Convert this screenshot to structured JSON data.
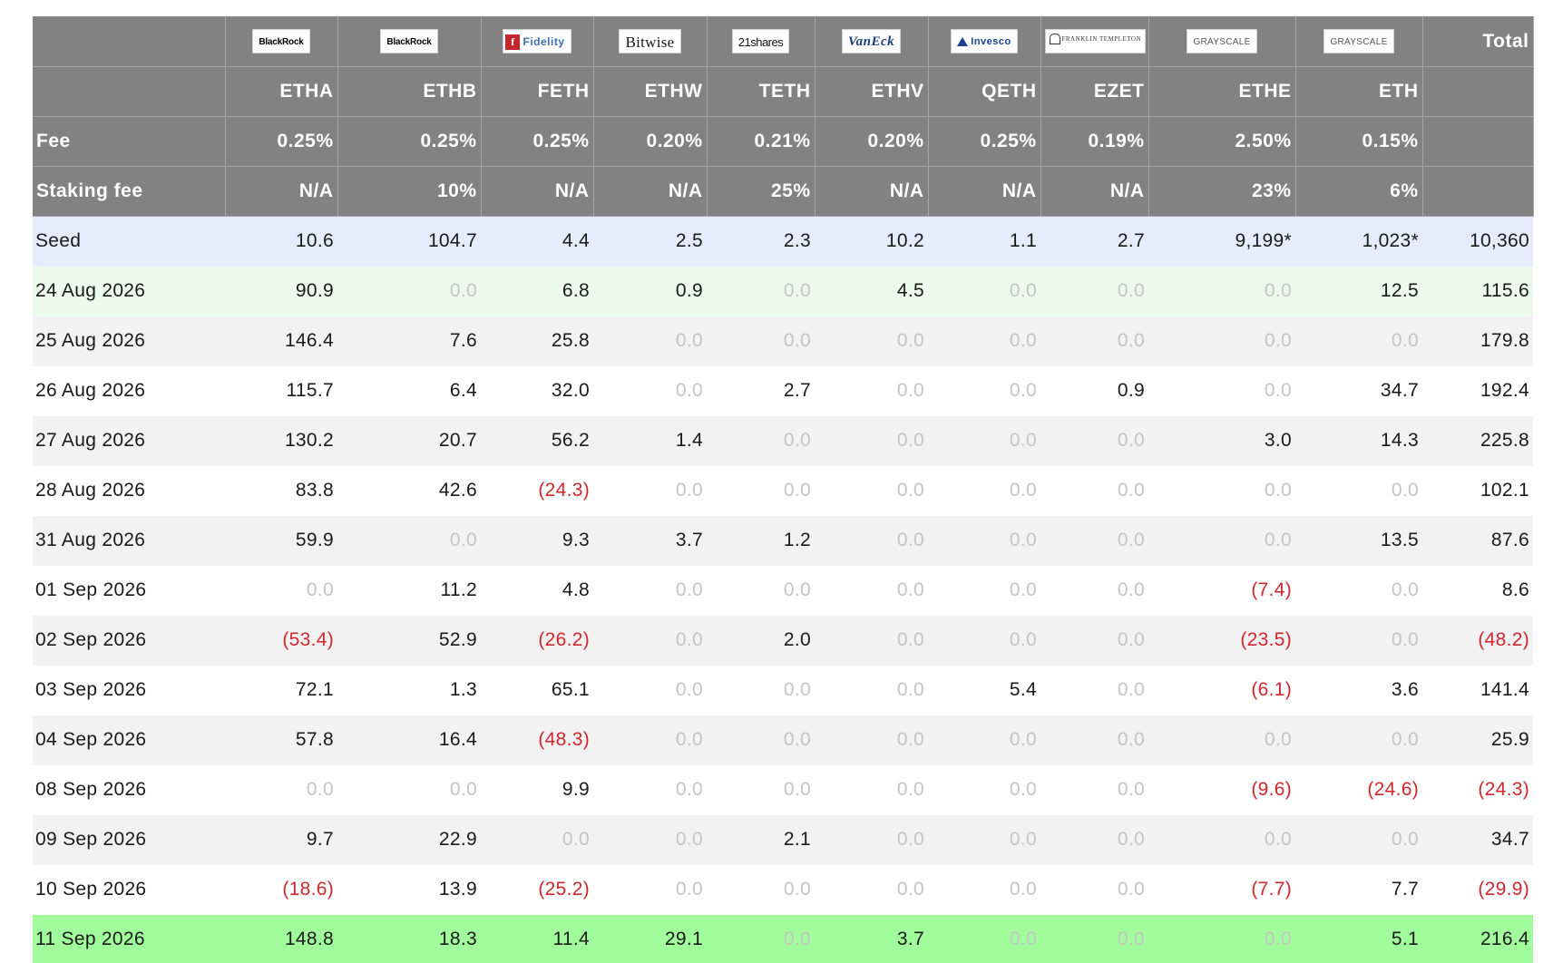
{
  "header": {
    "logos": [
      {
        "text": "BlackRock",
        "icon": "blackrock-logo"
      },
      {
        "text": "BlackRock",
        "icon": "blackrock-logo"
      },
      {
        "text": "Fidelity",
        "icon": "fidelity-logo"
      },
      {
        "text": "Bitwise",
        "icon": "bitwise-logo"
      },
      {
        "text": "21shares",
        "icon": "21shares-logo"
      },
      {
        "text": "VanEck",
        "icon": "vaneck-logo"
      },
      {
        "text": "Invesco",
        "icon": "invesco-logo"
      },
      {
        "text": "FRANKLIN TEMPLETON",
        "icon": "franklin-templeton-logo"
      },
      {
        "text": "GRAYSCALE",
        "icon": "grayscale-logo"
      },
      {
        "text": "GRAYSCALE",
        "icon": "grayscale-logo"
      }
    ],
    "total_label": "Total",
    "tickers": [
      "ETHA",
      "ETHB",
      "FETH",
      "ETHW",
      "TETH",
      "ETHV",
      "QETH",
      "EZET",
      "ETHE",
      "ETH"
    ],
    "fee_label": "Fee",
    "fees": [
      "0.25%",
      "0.25%",
      "0.25%",
      "0.20%",
      "0.21%",
      "0.20%",
      "0.25%",
      "0.19%",
      "2.50%",
      "0.15%"
    ],
    "staking_label": "Staking fee",
    "staking_fees": [
      "N/A",
      "10%",
      "N/A",
      "N/A",
      "25%",
      "N/A",
      "N/A",
      "N/A",
      "23%",
      "6%"
    ]
  },
  "rows": [
    {
      "label": "Seed",
      "values": [
        "10.6",
        "104.7",
        "4.4",
        "2.5",
        "2.3",
        "10.2",
        "1.1",
        "2.7",
        "9,199*",
        "1,023*"
      ],
      "total": "10,360",
      "style": "seed"
    },
    {
      "label": "24 Aug 2026",
      "values": [
        "90.9",
        "0.0",
        "6.8",
        "0.9",
        "0.0",
        "4.5",
        "0.0",
        "0.0",
        "0.0",
        "12.5"
      ],
      "total": "115.6",
      "style": "green-light"
    },
    {
      "label": "25 Aug 2026",
      "values": [
        "146.4",
        "7.6",
        "25.8",
        "0.0",
        "0.0",
        "0.0",
        "0.0",
        "0.0",
        "0.0",
        "0.0"
      ],
      "total": "179.8",
      "style": "even"
    },
    {
      "label": "26 Aug 2026",
      "values": [
        "115.7",
        "6.4",
        "32.0",
        "0.0",
        "2.7",
        "0.0",
        "0.0",
        "0.9",
        "0.0",
        "34.7"
      ],
      "total": "192.4",
      "style": "odd"
    },
    {
      "label": "27 Aug 2026",
      "values": [
        "130.2",
        "20.7",
        "56.2",
        "1.4",
        "0.0",
        "0.0",
        "0.0",
        "0.0",
        "3.0",
        "14.3"
      ],
      "total": "225.8",
      "style": "even"
    },
    {
      "label": "28 Aug 2026",
      "values": [
        "83.8",
        "42.6",
        "(24.3)",
        "0.0",
        "0.0",
        "0.0",
        "0.0",
        "0.0",
        "0.0",
        "0.0"
      ],
      "total": "102.1",
      "style": "odd"
    },
    {
      "label": "31 Aug 2026",
      "values": [
        "59.9",
        "0.0",
        "9.3",
        "3.7",
        "1.2",
        "0.0",
        "0.0",
        "0.0",
        "0.0",
        "13.5"
      ],
      "total": "87.6",
      "style": "even"
    },
    {
      "label": "01 Sep 2026",
      "values": [
        "0.0",
        "11.2",
        "4.8",
        "0.0",
        "0.0",
        "0.0",
        "0.0",
        "0.0",
        "(7.4)",
        "0.0"
      ],
      "total": "8.6",
      "style": "odd"
    },
    {
      "label": "02 Sep 2026",
      "values": [
        "(53.4)",
        "52.9",
        "(26.2)",
        "0.0",
        "2.0",
        "0.0",
        "0.0",
        "0.0",
        "(23.5)",
        "0.0"
      ],
      "total": "(48.2)",
      "style": "even"
    },
    {
      "label": "03 Sep 2026",
      "values": [
        "72.1",
        "1.3",
        "65.1",
        "0.0",
        "0.0",
        "0.0",
        "5.4",
        "0.0",
        "(6.1)",
        "3.6"
      ],
      "total": "141.4",
      "style": "odd"
    },
    {
      "label": "04 Sep 2026",
      "values": [
        "57.8",
        "16.4",
        "(48.3)",
        "0.0",
        "0.0",
        "0.0",
        "0.0",
        "0.0",
        "0.0",
        "0.0"
      ],
      "total": "25.9",
      "style": "even"
    },
    {
      "label": "08 Sep 2026",
      "values": [
        "0.0",
        "0.0",
        "9.9",
        "0.0",
        "0.0",
        "0.0",
        "0.0",
        "0.0",
        "(9.6)",
        "(24.6)"
      ],
      "total": "(24.3)",
      "style": "odd"
    },
    {
      "label": "09 Sep 2026",
      "values": [
        "9.7",
        "22.9",
        "0.0",
        "0.0",
        "2.1",
        "0.0",
        "0.0",
        "0.0",
        "0.0",
        "0.0"
      ],
      "total": "34.7",
      "style": "even"
    },
    {
      "label": "10 Sep 2026",
      "values": [
        "(18.6)",
        "13.9",
        "(25.2)",
        "0.0",
        "0.0",
        "0.0",
        "0.0",
        "0.0",
        "(7.7)",
        "7.7"
      ],
      "total": "(29.9)",
      "style": "odd"
    },
    {
      "label": "11 Sep 2026",
      "values": [
        "148.8",
        "18.3",
        "11.4",
        "29.1",
        "0.0",
        "3.7",
        "0.0",
        "0.0",
        "0.0",
        "5.1"
      ],
      "total": "216.4",
      "style": "highlight"
    }
  ],
  "colors": {
    "header_bg": "#828282",
    "negative": "#d0262d",
    "zero": "#c4c4c4",
    "seed_bg": "#e6ecfb",
    "highlight_bg": "#a1fc9c"
  }
}
